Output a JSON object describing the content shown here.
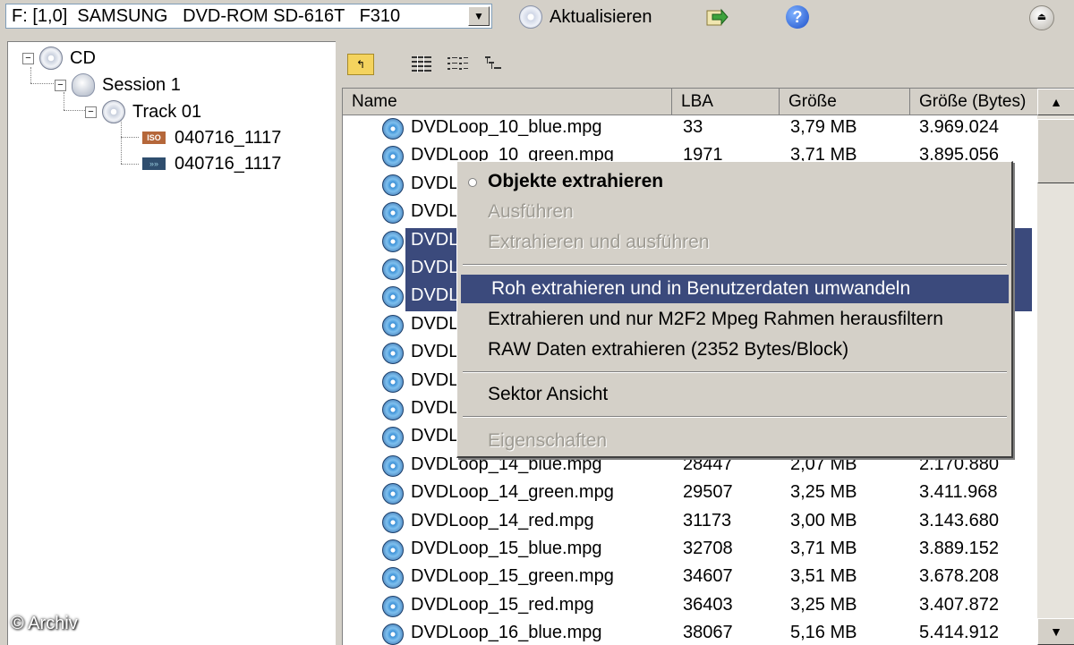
{
  "toolbar": {
    "drive": "F: [1,0]  SAMSUNG   DVD-ROM SD-616T   F310",
    "refresh_label": "Aktualisieren",
    "help_glyph": "?"
  },
  "tree": {
    "root": "CD",
    "session": "Session 1",
    "track": "Track 01",
    "files": [
      {
        "label": "040716_1117",
        "icon_text": "ISO"
      },
      {
        "label": "040716_1117",
        "icon_text": "»»"
      }
    ]
  },
  "list": {
    "columns": [
      "Name",
      "LBA",
      "Größe",
      "Größe (Bytes)"
    ],
    "rows": [
      {
        "name": "DVDLoop_10_blue.mpg",
        "lba": "33",
        "size": "3,79 MB",
        "bytes": "3.969.024"
      },
      {
        "name": "DVDLoop_10_green.mpg",
        "lba": "1971",
        "size": "3,71 MB",
        "bytes": "3.895.056"
      },
      {
        "name": "DVDL",
        "lba": "",
        "size": "",
        "bytes": ""
      },
      {
        "name": "DVDL",
        "lba": "",
        "size": "",
        "bytes": ""
      },
      {
        "name": "DVDL",
        "lba": "",
        "size": "",
        "bytes": ""
      },
      {
        "name": "DVDL",
        "lba": "",
        "size": "",
        "bytes": ""
      },
      {
        "name": "DVDL",
        "lba": "",
        "size": "",
        "bytes": ""
      },
      {
        "name": "DVDL",
        "lba": "",
        "size": "",
        "bytes": ""
      },
      {
        "name": "DVDL",
        "lba": "",
        "size": "",
        "bytes": ""
      },
      {
        "name": "DVDL",
        "lba": "",
        "size": "",
        "bytes": ""
      },
      {
        "name": "DVDL",
        "lba": "",
        "size": "",
        "bytes": ""
      },
      {
        "name": "DVDL",
        "lba": "",
        "size": "",
        "bytes": ""
      },
      {
        "name": "DVDLoop_14_blue.mpg",
        "lba": "28447",
        "size": "2,07 MB",
        "bytes": "2.170.880"
      },
      {
        "name": "DVDLoop_14_green.mpg",
        "lba": "29507",
        "size": "3,25 MB",
        "bytes": "3.411.968"
      },
      {
        "name": "DVDLoop_14_red.mpg",
        "lba": "31173",
        "size": "3,00 MB",
        "bytes": "3.143.680"
      },
      {
        "name": "DVDLoop_15_blue.mpg",
        "lba": "32708",
        "size": "3,71 MB",
        "bytes": "3.889.152"
      },
      {
        "name": "DVDLoop_15_green.mpg",
        "lba": "34607",
        "size": "3,51 MB",
        "bytes": "3.678.208"
      },
      {
        "name": "DVDLoop_15_red.mpg",
        "lba": "36403",
        "size": "3,25 MB",
        "bytes": "3.407.872"
      },
      {
        "name": "DVDLoop_16_blue.mpg",
        "lba": "38067",
        "size": "5,16 MB",
        "bytes": "5.414.912"
      }
    ],
    "selected_rows": [
      4,
      5,
      6
    ]
  },
  "context_menu": {
    "items": [
      {
        "label": "Objekte extrahieren",
        "state": "bold"
      },
      {
        "label": "Ausführen",
        "state": "disabled"
      },
      {
        "label": "Extrahieren und ausführen",
        "state": "disabled"
      },
      {
        "label": "Roh extrahieren und in Benutzerdaten umwandeln",
        "state": "highlighted"
      },
      {
        "label": "Extrahieren und nur M2F2 Mpeg Rahmen herausfiltern",
        "state": "normal"
      },
      {
        "label": "RAW Daten extrahieren (2352 Bytes/Block)",
        "state": "normal"
      },
      {
        "label": "Sektor Ansicht",
        "state": "normal"
      },
      {
        "label": "Eigenschaften",
        "state": "disabled"
      }
    ]
  },
  "watermark": "© Archiv",
  "colors": {
    "window_bg": "#d4d0c8",
    "selection": "#3b4a7c",
    "disabled_text": "#9e9b93"
  }
}
